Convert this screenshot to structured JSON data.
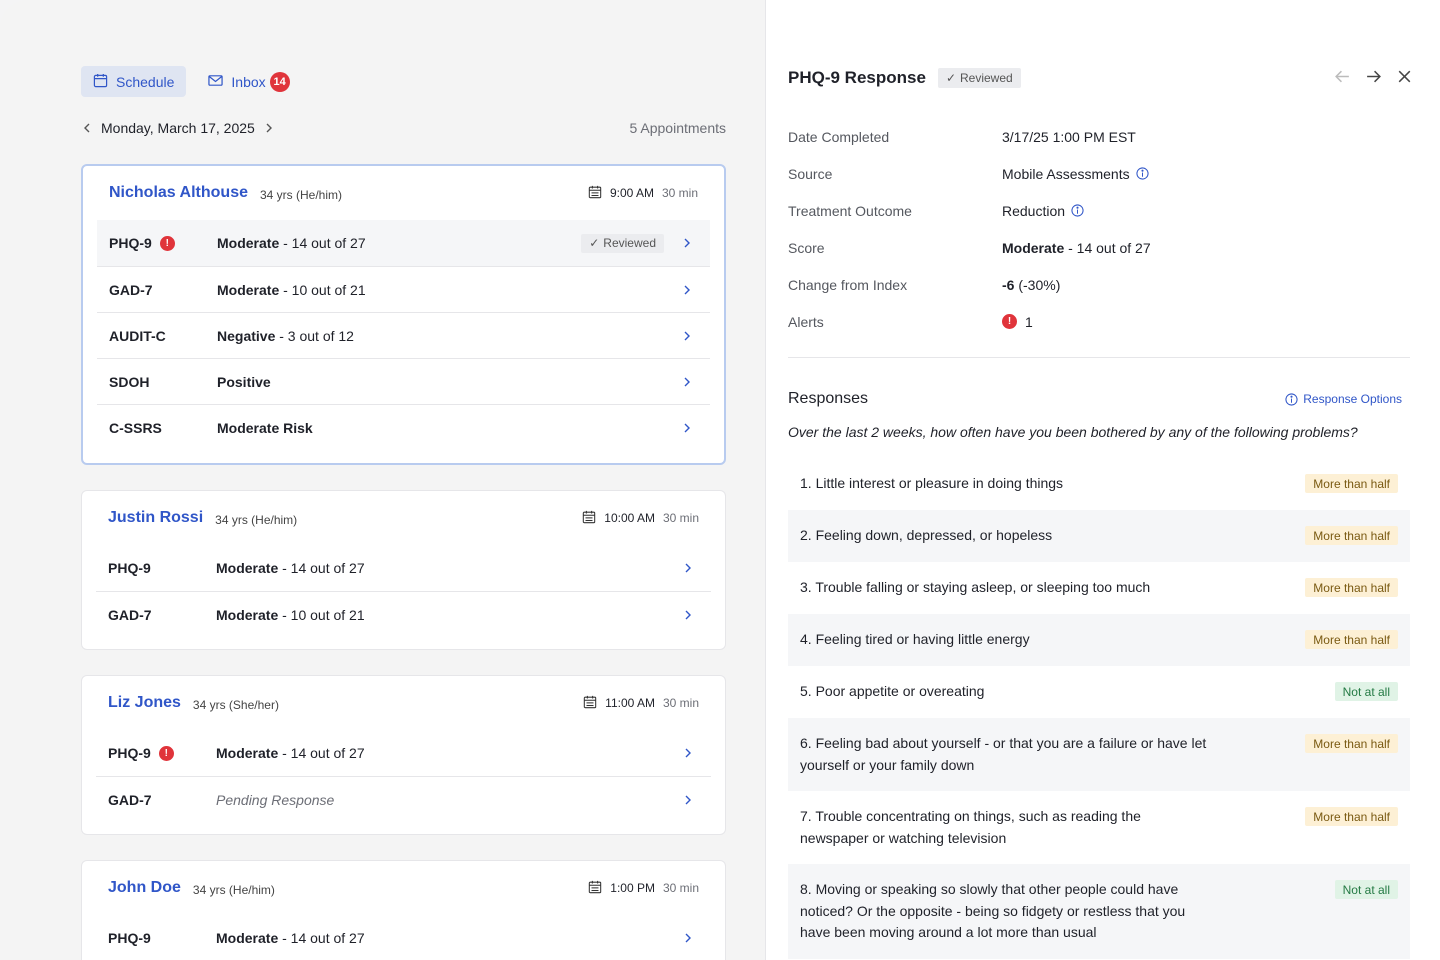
{
  "nav": {
    "schedule_label": "Schedule",
    "inbox_label": "Inbox",
    "inbox_count": "14"
  },
  "date": {
    "label": "Monday, March 17, 2025",
    "appointments": "5 Appointments"
  },
  "patients": [
    {
      "name": "Nicholas Althouse",
      "meta": "34 yrs (He/him)",
      "time": "9:00 AM",
      "duration": "30 min",
      "rows": [
        {
          "code": "PHQ-9",
          "severity": "Moderate",
          "detail": " - 14 out of 27",
          "reviewed": "Reviewed",
          "alert": "!"
        },
        {
          "code": "GAD-7",
          "severity": "Moderate",
          "detail": " - 10 out of 21"
        },
        {
          "code": "AUDIT-C",
          "severity": "Negative",
          "detail": " - 3 out of 12"
        },
        {
          "code": "SDOH",
          "severity": "Positive",
          "detail": ""
        },
        {
          "code": "C-SSRS",
          "severity": "Moderate Risk",
          "detail": ""
        }
      ]
    },
    {
      "name": "Justin Rossi",
      "meta": "34 yrs (He/him)",
      "time": "10:00 AM",
      "duration": "30 min",
      "rows": [
        {
          "code": "PHQ-9",
          "severity": "Moderate",
          "detail": " - 14 out of 27"
        },
        {
          "code": "GAD-7",
          "severity": "Moderate",
          "detail": " - 10 out of 21"
        }
      ]
    },
    {
      "name": "Liz Jones",
      "meta": "34 yrs (She/her)",
      "time": "11:00 AM",
      "duration": "30 min",
      "rows": [
        {
          "code": "PHQ-9",
          "severity": "Moderate",
          "detail": " - 14 out of 27",
          "alert": "!"
        },
        {
          "code": "GAD-7",
          "pending": "Pending Response"
        }
      ]
    },
    {
      "name": "John Doe",
      "meta": "34 yrs (He/him)",
      "time": "1:00 PM",
      "duration": "30 min",
      "rows": [
        {
          "code": "PHQ-9",
          "severity": "Moderate",
          "detail": " - 14 out of 27"
        }
      ]
    }
  ],
  "detail": {
    "title": "PHQ-9 Response",
    "status": "Reviewed",
    "fields": [
      {
        "label": "Date Completed",
        "value": "3/17/25 1:00 PM EST"
      },
      {
        "label": "Source",
        "value": "Mobile Assessments"
      },
      {
        "label": "Treatment Outcome",
        "value": "Reduction"
      },
      {
        "label": "Score",
        "value_bold": "Moderate",
        "value": " - 14 out of 27"
      },
      {
        "label": "Change from Index",
        "value_bold": "-6",
        "value": " (-30%)"
      },
      {
        "label": "Alerts",
        "value": "1",
        "alert": "!"
      }
    ],
    "responses_title": "Responses",
    "response_options": "Response Options",
    "question": "Over the last 2 weeks, how often have you been bothered by any of the following problems?",
    "items": [
      {
        "text": "1. Little interest or pleasure in doing things",
        "answer": "More than half",
        "tone": "warn"
      },
      {
        "text": "2. Feeling down, depressed, or hopeless",
        "answer": "More than half",
        "tone": "warn"
      },
      {
        "text": "3. Trouble falling or staying asleep, or sleeping too much",
        "answer": "More than half",
        "tone": "warn"
      },
      {
        "text": "4. Feeling tired or having little energy",
        "answer": "More than half",
        "tone": "warn"
      },
      {
        "text": "5. Poor appetite or overeating",
        "answer": "Not at all",
        "tone": "ok"
      },
      {
        "text": "6. Feeling bad about yourself - or that you are a failure or have let yourself or your family down",
        "answer": "More than half",
        "tone": "warn"
      },
      {
        "text": "7. Trouble concentrating on things, such as reading the newspaper or watching television",
        "answer": "More than half",
        "tone": "warn"
      },
      {
        "text": "8. Moving or speaking so slowly that other people could have noticed? Or the opposite - being so fidgety or restless that you have been moving around a lot more than usual",
        "answer": "Not at all",
        "tone": "ok"
      }
    ]
  },
  "colors": {
    "accent": "#3056c8",
    "alert": "#e0343b",
    "warn_bg": "#fdf0d5",
    "ok_bg": "#e0f3e6"
  }
}
